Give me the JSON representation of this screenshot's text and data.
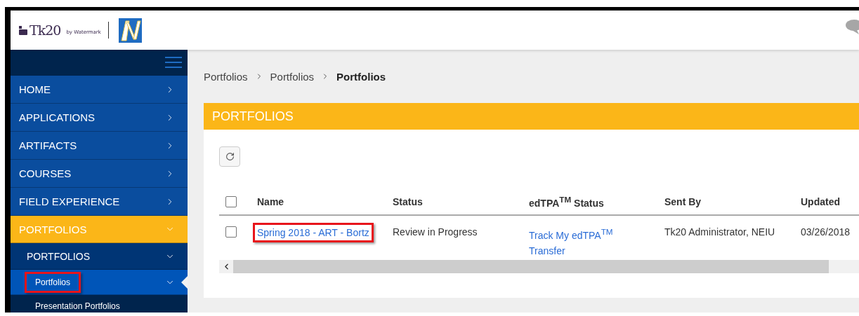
{
  "header": {
    "logo_text": "Tk20",
    "logo_byline": "by Watermark"
  },
  "sidebar": {
    "items": [
      {
        "label": "HOME",
        "expanded": false,
        "selected": false
      },
      {
        "label": "APPLICATIONS",
        "expanded": false,
        "selected": false
      },
      {
        "label": "ARTIFACTS",
        "expanded": false,
        "selected": false
      },
      {
        "label": "COURSES",
        "expanded": false,
        "selected": false
      },
      {
        "label": "FIELD EXPERIENCE",
        "expanded": false,
        "selected": false
      },
      {
        "label": "PORTFOLIOS",
        "expanded": true,
        "selected": true,
        "children": [
          {
            "label": "PORTFOLIOS",
            "expanded": true,
            "children": [
              {
                "label": "Portfolios",
                "kind": "folder",
                "selected": true,
                "highlighted": true
              },
              {
                "label": "Presentation Portfolios",
                "kind": "leaf",
                "selected": false,
                "highlighted": false
              }
            ]
          }
        ]
      }
    ]
  },
  "breadcrumb": [
    "Portfolios",
    "Portfolios",
    "Portfolios"
  ],
  "panel": {
    "title": "PORTFOLIOS",
    "table": {
      "header_checked": false,
      "columns": [
        "Name",
        "Status",
        "edTPA$^{TM}$ Status",
        "Sent By",
        "Updated"
      ],
      "rows": [
        {
          "checked": false,
          "name": "Spring 2018 - ART - Bortz",
          "highlighted": true,
          "status": "Review in Progress",
          "edtpa_status": "Track My edTPA$^{TM}$ Transfer",
          "sent_by": "Tk20 Administrator, NEIU",
          "updated": "03/26/2018"
        }
      ]
    }
  }
}
